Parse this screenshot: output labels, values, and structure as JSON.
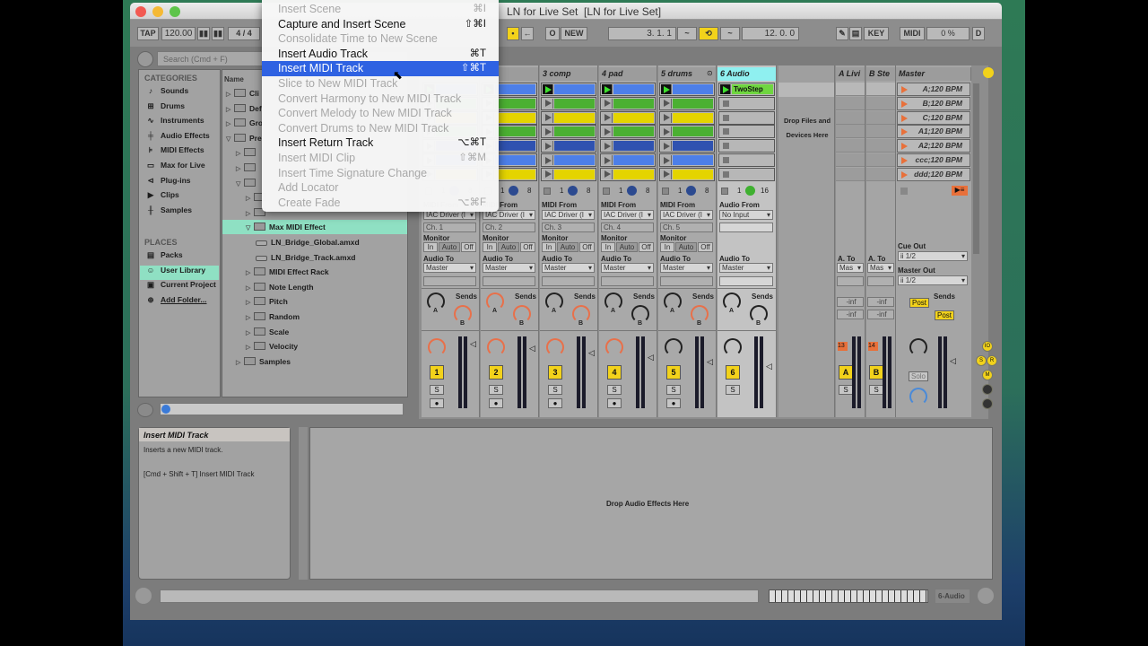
{
  "window": {
    "title": "LN for Live Set  [LN for Live Set]"
  },
  "toolbar": {
    "tap": "TAP",
    "tempo": "120.00",
    "time_sig": "4 / 4",
    "new": "NEW",
    "position": "3.   1.   1",
    "loop_length": "12.   0.   0",
    "key": "KEY",
    "midi": "MIDI",
    "cpu": "0 %",
    "disk": "D"
  },
  "menu": {
    "items": [
      {
        "label": "Insert Scene",
        "shortcut": "⌘I",
        "enabled": false
      },
      {
        "label": "Capture and Insert Scene",
        "shortcut": "⇧⌘I",
        "enabled": true
      },
      {
        "label": "Consolidate Time to New Scene",
        "shortcut": "",
        "enabled": false
      },
      {
        "label": "Insert Audio Track",
        "shortcut": "⌘T",
        "enabled": true
      },
      {
        "label": "Insert MIDI Track",
        "shortcut": "⇧⌘T",
        "enabled": true,
        "highlighted": true
      },
      {
        "label": "Slice to New MIDI Track",
        "shortcut": "",
        "enabled": false
      },
      {
        "label": "Convert Harmony to New MIDI Track",
        "shortcut": "",
        "enabled": false
      },
      {
        "label": "Convert Melody to New MIDI Track",
        "shortcut": "",
        "enabled": false
      },
      {
        "label": "Convert Drums to New MIDI Track",
        "shortcut": "",
        "enabled": false
      },
      {
        "label": "Insert Return Track",
        "shortcut": "⌥⌘T",
        "enabled": true
      },
      {
        "label": "Insert MIDI Clip",
        "shortcut": "⇧⌘M",
        "enabled": false
      },
      {
        "label": "Insert Time Signature Change",
        "shortcut": "",
        "enabled": false
      },
      {
        "label": "Add Locator",
        "shortcut": "",
        "enabled": false
      },
      {
        "label": "Create Fade",
        "shortcut": "⌥⌘F",
        "enabled": false
      }
    ]
  },
  "browser": {
    "search_placeholder": "Search (Cmd + F)",
    "categories_title": "CATEGORIES",
    "categories": [
      {
        "label": "Sounds",
        "icon": "note-icon"
      },
      {
        "label": "Drums",
        "icon": "grid-icon"
      },
      {
        "label": "Instruments",
        "icon": "wave-icon"
      },
      {
        "label": "Audio Effects",
        "icon": "audio-fx-icon"
      },
      {
        "label": "MIDI Effects",
        "icon": "midi-fx-icon"
      },
      {
        "label": "Max for Live",
        "icon": "max-icon"
      },
      {
        "label": "Plug-ins",
        "icon": "plugin-icon"
      },
      {
        "label": "Clips",
        "icon": "clip-icon"
      },
      {
        "label": "Samples",
        "icon": "sample-icon"
      }
    ],
    "places_title": "PLACES",
    "places": [
      {
        "label": "Packs",
        "icon": "packs-icon"
      },
      {
        "label": "User Library",
        "icon": "user-icon",
        "selected": true
      },
      {
        "label": "Current Project",
        "icon": "project-icon"
      },
      {
        "label": "Add Folder...",
        "icon": "add-icon"
      }
    ],
    "name_header": "Name",
    "files": [
      {
        "label": "Cli",
        "depth": 0,
        "type": "folder",
        "expanded": false
      },
      {
        "label": "Def",
        "depth": 0,
        "type": "folder",
        "expanded": false
      },
      {
        "label": "Gro",
        "depth": 0,
        "type": "folder",
        "expanded": false
      },
      {
        "label": "Pre",
        "depth": 0,
        "type": "folder",
        "expanded": true
      },
      {
        "label": "",
        "depth": 1,
        "type": "folder",
        "expanded": false
      },
      {
        "label": "",
        "depth": 1,
        "type": "folder",
        "expanded": false
      },
      {
        "label": "",
        "depth": 1,
        "type": "folder",
        "expanded": true
      },
      {
        "label": "",
        "depth": 2,
        "type": "folder",
        "expanded": false
      },
      {
        "label": "",
        "depth": 2,
        "type": "folder",
        "expanded": false
      },
      {
        "label": "Max MIDI Effect",
        "depth": 2,
        "type": "folder",
        "expanded": true,
        "selected": true
      },
      {
        "label": "LN_Bridge_Global.amxd",
        "depth": 3,
        "type": "device"
      },
      {
        "label": "LN_Bridge_Track.amxd",
        "depth": 3,
        "type": "device"
      },
      {
        "label": "MIDI Effect Rack",
        "depth": 2,
        "type": "folder",
        "expanded": false
      },
      {
        "label": "Note Length",
        "depth": 2,
        "type": "folder",
        "expanded": false
      },
      {
        "label": "Pitch",
        "depth": 2,
        "type": "folder",
        "expanded": false
      },
      {
        "label": "Random",
        "depth": 2,
        "type": "folder",
        "expanded": false
      },
      {
        "label": "Scale",
        "depth": 2,
        "type": "folder",
        "expanded": false
      },
      {
        "label": "Velocity",
        "depth": 2,
        "type": "folder",
        "expanded": false
      },
      {
        "label": "Samples",
        "depth": 1,
        "type": "folder",
        "expanded": false
      }
    ]
  },
  "clip_colors": [
    "#4d7fe8",
    "#4bb032",
    "#e4d400",
    "#4bb032",
    "#2f52b0",
    "#4d7fe8",
    "#e4d400"
  ],
  "tracks": [
    {
      "name": "",
      "number": "1",
      "input_label": "MIDI From",
      "input": "IAC Driver (I",
      "channel": "Ch. 1",
      "monitor": [
        "In",
        "Auto",
        "Off"
      ],
      "output_label": "Audio To",
      "output": "Master",
      "status": [
        "1",
        "8"
      ],
      "has_clips": true
    },
    {
      "name": "ad",
      "number": "2",
      "input_label": "MIDI From",
      "input": "IAC Driver (I",
      "channel": "Ch. 2",
      "monitor": [
        "In",
        "Auto",
        "Off"
      ],
      "output_label": "Audio To",
      "output": "Master",
      "status": [
        "1",
        "8"
      ],
      "has_clips": true
    },
    {
      "name": "3 comp",
      "number": "3",
      "input_label": "MIDI From",
      "input": "IAC Driver (I",
      "channel": "Ch. 3",
      "monitor": [
        "In",
        "Auto",
        "Off"
      ],
      "output_label": "Audio To",
      "output": "Master",
      "status": [
        "1",
        "8"
      ],
      "has_clips": true
    },
    {
      "name": "4 pad",
      "number": "4",
      "input_label": "MIDI From",
      "input": "IAC Driver (I",
      "channel": "Ch. 4",
      "monitor": [
        "In",
        "Auto",
        "Off"
      ],
      "output_label": "Audio To",
      "output": "Master",
      "status": [
        "1",
        "8"
      ],
      "has_clips": true
    },
    {
      "name": "5 drums",
      "number": "5",
      "input_label": "MIDI From",
      "input": "IAC Driver (I",
      "channel": "Ch. 5",
      "monitor": [
        "In",
        "Auto",
        "Off"
      ],
      "output_label": "Audio To",
      "output": "Master",
      "status": [
        "1",
        "8"
      ],
      "has_clips": true
    },
    {
      "name": "6 Audio",
      "number": "6",
      "input_label": "Audio From",
      "input": "No Input",
      "channel": "",
      "monitor": [],
      "output_label": "Audio To",
      "output": "Master",
      "status": [
        "1",
        "16"
      ],
      "has_clips": false,
      "clip": "TwoStep",
      "selected": true
    }
  ],
  "sends_label": "Sends",
  "knob_a": "A",
  "knob_b": "B",
  "solo": "S",
  "drop_zone": "Drop Files and Devices Here",
  "returns": [
    {
      "name": "A Livi",
      "letter": "A",
      "number": "13",
      "to_label": "A. To",
      "to": "Mas",
      "send1": "-inf",
      "send2": "-inf"
    },
    {
      "name": "B Ste",
      "letter": "B",
      "number": "14",
      "to_label": "A. To",
      "to": "Mas",
      "send1": "-inf",
      "send2": "-inf"
    }
  ],
  "master": {
    "name": "Master",
    "scenes": [
      "A;120 BPM",
      "B;120 BPM",
      "C;120 BPM",
      "A1;120 BPM",
      "A2;120 BPM",
      "ccc;120 BPM",
      "ddd;120 BPM"
    ],
    "cue_out_label": "Cue Out",
    "cue_out": "ii 1/2",
    "master_out_label": "Master Out",
    "master_out": "ii 1/2",
    "post1": "Post",
    "post2": "Post",
    "solo": "Solo"
  },
  "info": {
    "title": "Insert MIDI Track",
    "desc": "Inserts a new MIDI track.",
    "shortcut": "[Cmd + Shift + T] Insert MIDI Track"
  },
  "device": {
    "drop": "Drop Audio Effects Here"
  },
  "status": {
    "track": "6-Audio"
  },
  "colors": {
    "accent": "#f2d21b",
    "selection": "#8fe0c3",
    "menu_highlight": "#2f62e2",
    "track_selected": "#8ff0f0"
  }
}
